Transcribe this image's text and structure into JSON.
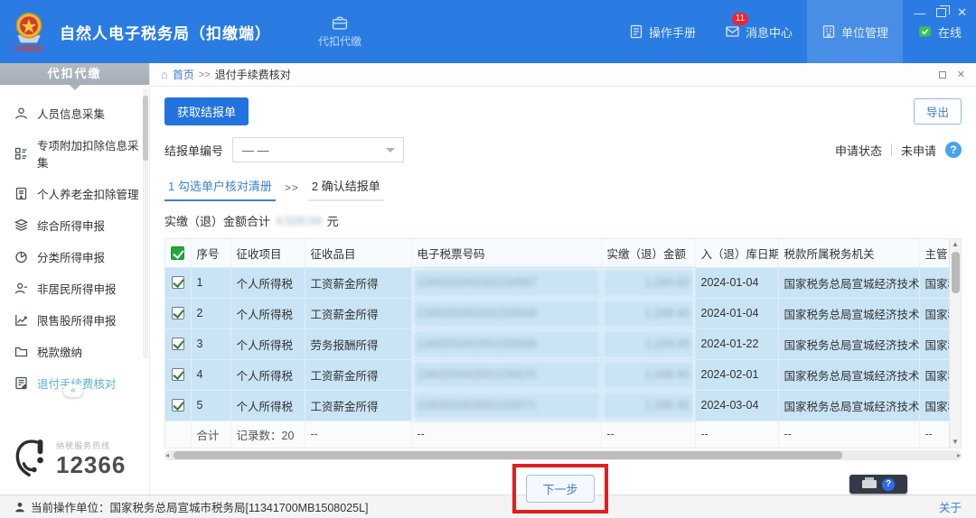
{
  "header": {
    "app_title": "自然人电子税务局（扣缴端）",
    "logo_caption": "中国税务",
    "module_tab": "代扣代缴",
    "nav": [
      {
        "label": "操作手册"
      },
      {
        "label": "消息中心",
        "badge": "11"
      },
      {
        "label": "单位管理"
      },
      {
        "label": "在线"
      }
    ],
    "window": {
      "minimize": "—",
      "close": "✕"
    }
  },
  "sidebar": {
    "header": "代扣代缴",
    "items": [
      {
        "label": "人员信息采集"
      },
      {
        "label": "专项附加扣除信息采集"
      },
      {
        "label": "个人养老金扣除管理"
      },
      {
        "label": "综合所得申报"
      },
      {
        "label": "分类所得申报"
      },
      {
        "label": "非居民所得申报"
      },
      {
        "label": "限售股所得申报"
      },
      {
        "label": "税款缴纳"
      },
      {
        "label": "退付手续费核对"
      }
    ],
    "collapse": "«",
    "hotline_caption": "纳税服务热线",
    "hotline_number": "12366"
  },
  "breadcrumb": {
    "home": "首页",
    "separator": ">>",
    "current": "退付手续费核对",
    "close": "✕"
  },
  "toolbar": {
    "fetch": "获取结报单",
    "export": "导出"
  },
  "filter": {
    "label": "结报单编号",
    "value": "— —",
    "status_label": "申请状态",
    "status_value": "未申请",
    "help": "?"
  },
  "steps": {
    "step1": "1 勾选单户核对清册",
    "separator": ">>",
    "step2": "2 确认结报单"
  },
  "summary": {
    "label": "实缴（退）金额合计",
    "masked_value": "4,529.54",
    "unit": "元"
  },
  "table": {
    "headers": [
      "序号",
      "征收项目",
      "征收品目",
      "电子税票号码",
      "实缴（退）金额",
      "入（退）库日期",
      "税款所属税务机关",
      "主管"
    ],
    "rows": [
      {
        "no": "1",
        "item": "个人所得税",
        "sub": "工资薪金所得",
        "ticket_masked": "1340202401001234567",
        "amount_masked": "1,294.60",
        "date": "2024-01-04",
        "org": "国家税务总局宣城经济技术...",
        "mgr": "国家税..."
      },
      {
        "no": "2",
        "item": "个人所得税",
        "sub": "工资薪金所得",
        "ticket_masked": "1340202401001234568",
        "amount_masked": "1,298.40",
        "date": "2024-01-04",
        "org": "国家税务总局宣城经济技术...",
        "mgr": "国家税..."
      },
      {
        "no": "3",
        "item": "个人所得税",
        "sub": "劳务报酬所得",
        "ticket_masked": "1340202401001234569",
        "amount_masked": "1,194.40",
        "date": "2024-01-22",
        "org": "国家税务总局宣城经济技术...",
        "mgr": "国家税..."
      },
      {
        "no": "4",
        "item": "个人所得税",
        "sub": "工资薪金所得",
        "ticket_masked": "1340202402001234570",
        "amount_masked": "1,398.40",
        "date": "2024-02-01",
        "org": "国家税务总局宣城经济技术...",
        "mgr": "国家税..."
      },
      {
        "no": "5",
        "item": "个人所得税",
        "sub": "工资薪金所得",
        "ticket_masked": "1340202403001234571",
        "amount_masked": "1,398.40",
        "date": "2024-03-04",
        "org": "国家税务总局宣城经济技术...",
        "mgr": "国家税..."
      }
    ],
    "total_label": "合计",
    "total_count": "记录数：20",
    "placeholder": "--"
  },
  "footer": {
    "next": "下一步"
  },
  "statusbar": {
    "text": "当前操作单位：国家税务总局宣城市税务局[11341700MB1508025L]",
    "about": "关于"
  }
}
